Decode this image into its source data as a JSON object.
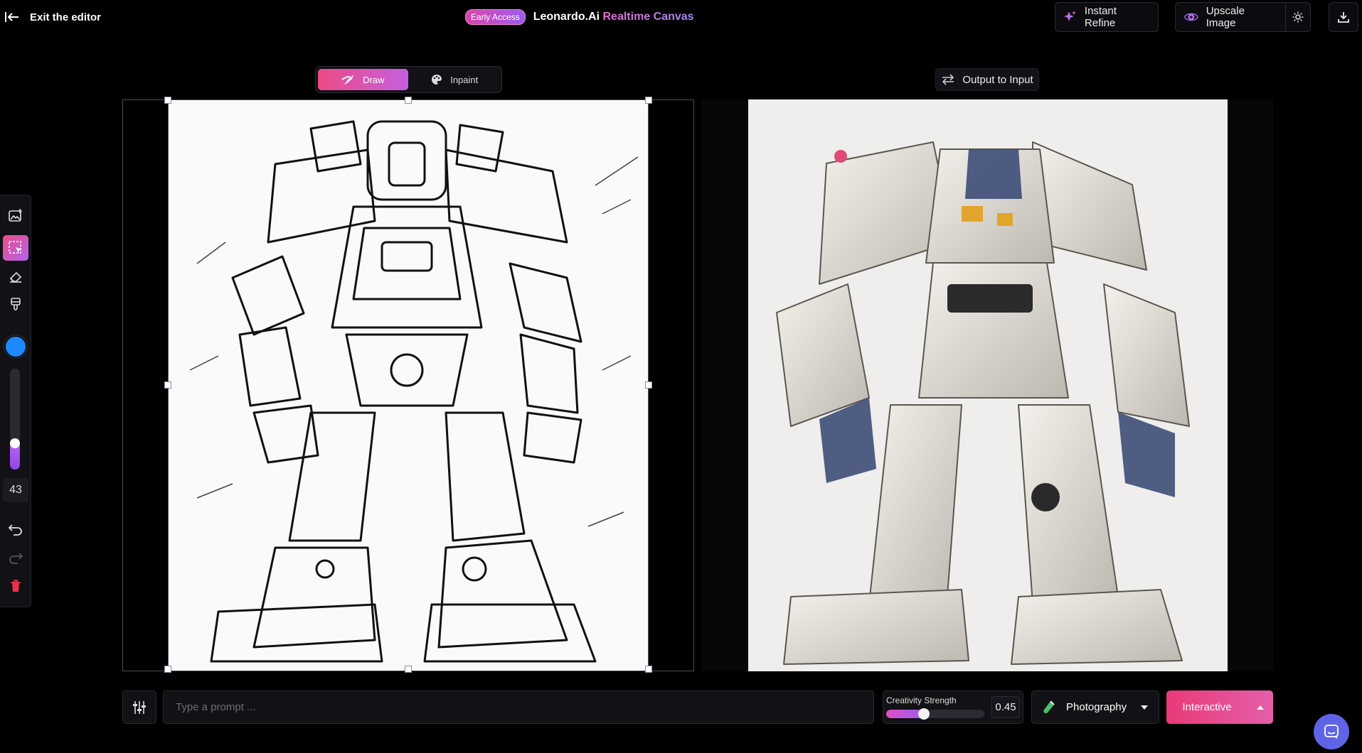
{
  "header": {
    "exit_label": "Exit the editor",
    "badge": "Early Access",
    "brand": "Leonardo.Ai",
    "brand_accent": "Realtime Canvas",
    "instant_refine": "Instant Refine",
    "upscale": "Upscale Image"
  },
  "mode": {
    "draw": "Draw",
    "inpaint": "Inpaint",
    "active": "draw"
  },
  "output_to_input": "Output to Input",
  "toolbar": {
    "brush_color": "#1e88ff",
    "brush_size": "43",
    "tools": [
      "image-upload",
      "select",
      "eraser",
      "paint-brush"
    ],
    "active_tool": "select"
  },
  "bottom": {
    "prompt_placeholder": "Type a prompt ...",
    "creativity_label": "Creativity Strength",
    "creativity_value": "0.45",
    "style": "Photography",
    "generate": "Interactive"
  },
  "colors": {
    "accent_pink": "#ec4b86",
    "accent_purple": "#9b5cf0",
    "background": "#000000"
  }
}
